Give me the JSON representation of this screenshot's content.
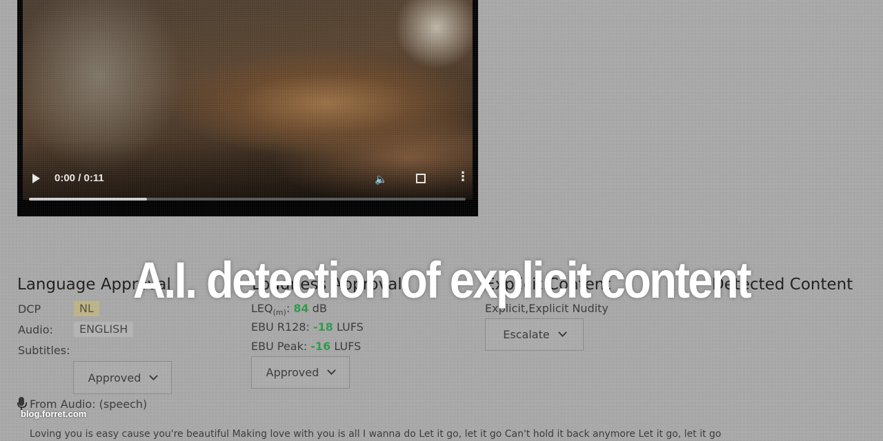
{
  "video": {
    "time": "0:00 / 0:11",
    "progress_fraction": 0.27,
    "icons": [
      "play-icon",
      "volume-icon",
      "fullscreen-icon",
      "more-icon"
    ]
  },
  "language": {
    "heading": "Language Approval",
    "dcp_label": "DCP",
    "dcp_value": "NL",
    "audio_label": "Audio:",
    "audio_value": "ENGLISH",
    "subtitles_label": "Subtitles:",
    "status": "Approved"
  },
  "loudness": {
    "heading": "Loudness Approval",
    "leq_label": "LEQ",
    "leq_sub": "(m)",
    "leq_value": "84",
    "leq_unit": "dB",
    "r128_label": "EBU R128:",
    "r128_value": "-18",
    "r128_unit": "LUFS",
    "peak_label": "EBU Peak:",
    "peak_value": "-16",
    "peak_unit": "LUFS",
    "status": "Approved"
  },
  "explicit": {
    "heading": "Explicit Content",
    "tags": "Explicit,Explicit Nudity",
    "status": "Escalate"
  },
  "fourth_heading": "Detected Content",
  "audio_source": "From Audio: (speech)",
  "transcript": "Loving you is easy cause you're beautiful Making love with you is all I wanna do Let it go, let it go Can't hold it back anymore Let it go, let it go",
  "overlay_title": "A.I. detection of explicit content",
  "watermark": "blog.forret.com",
  "colors": {
    "accent_green": "#2e9a4a",
    "nl_chip": "#bdb488"
  }
}
